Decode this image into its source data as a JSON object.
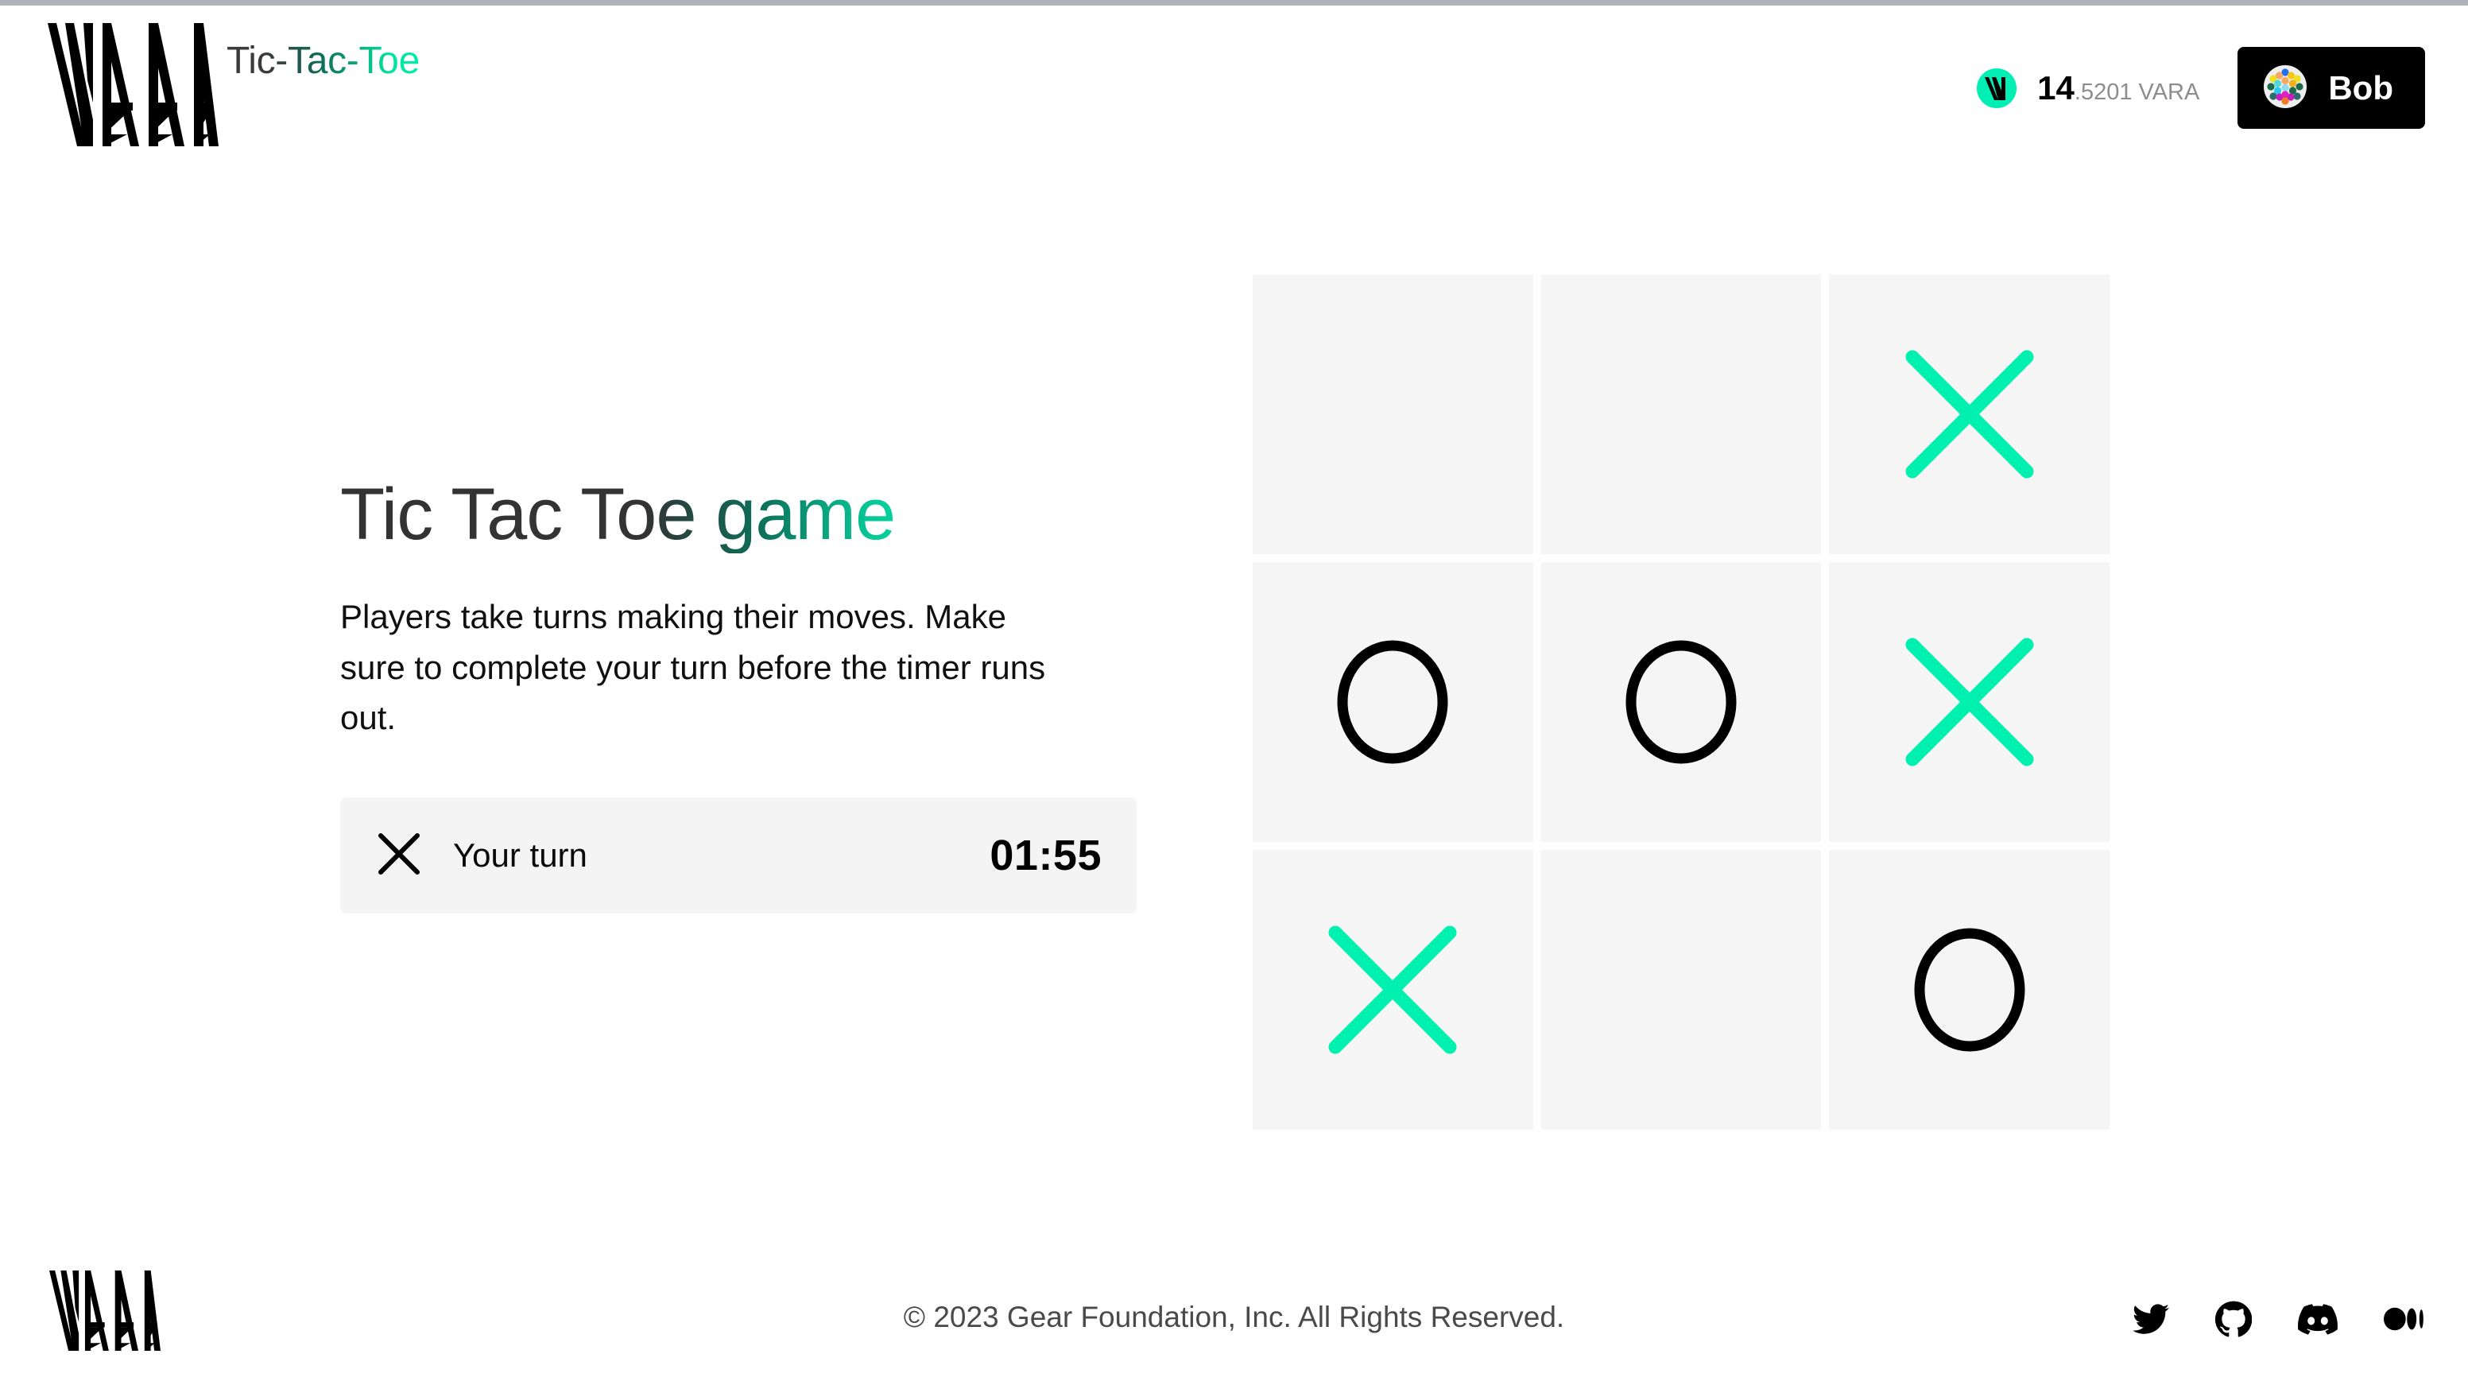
{
  "header": {
    "logo_name": "vara-logo",
    "app_title": "Tic-Tac-Toe",
    "balance": {
      "coin_icon": "vara-coin-icon",
      "integer": "14",
      "fraction": ".5201 VARA"
    },
    "account": {
      "avatar_icon": "polkadot-identicon-avatar",
      "name": "Bob"
    }
  },
  "main": {
    "headline_parts": {
      "full": "Tic Tac Toe game"
    },
    "blurb": "Players take turns making their moves. Make sure to complete your turn before the timer runs out.",
    "status": {
      "mark_icon": "x-mark-icon",
      "label": "Your turn",
      "timer": "01:55"
    }
  },
  "board": {
    "cells": [
      {
        "index": 0,
        "mark": "",
        "name": "board-cell-0"
      },
      {
        "index": 1,
        "mark": "",
        "name": "board-cell-1"
      },
      {
        "index": 2,
        "mark": "X",
        "name": "board-cell-2"
      },
      {
        "index": 3,
        "mark": "O",
        "name": "board-cell-3"
      },
      {
        "index": 4,
        "mark": "O",
        "name": "board-cell-4"
      },
      {
        "index": 5,
        "mark": "X",
        "name": "board-cell-5"
      },
      {
        "index": 6,
        "mark": "X",
        "name": "board-cell-6"
      },
      {
        "index": 7,
        "mark": "",
        "name": "board-cell-7"
      },
      {
        "index": 8,
        "mark": "O",
        "name": "board-cell-8"
      }
    ]
  },
  "footer": {
    "logo_name": "vara-logo",
    "copyright": "© 2023 Gear Foundation, Inc. All Rights Reserved.",
    "socials": [
      {
        "name": "twitter-icon",
        "label": "Twitter"
      },
      {
        "name": "github-icon",
        "label": "GitHub"
      },
      {
        "name": "discord-icon",
        "label": "Discord"
      },
      {
        "name": "medium-icon",
        "label": "Medium"
      }
    ]
  },
  "colors": {
    "accent_green": "#00f5b4",
    "coin_green": "#00efb4",
    "cell_bg": "#f5f5f5",
    "status_bg": "#f4f4f4",
    "mark_x": "#00f0b0",
    "mark_o": "#000000",
    "black": "#000000"
  }
}
